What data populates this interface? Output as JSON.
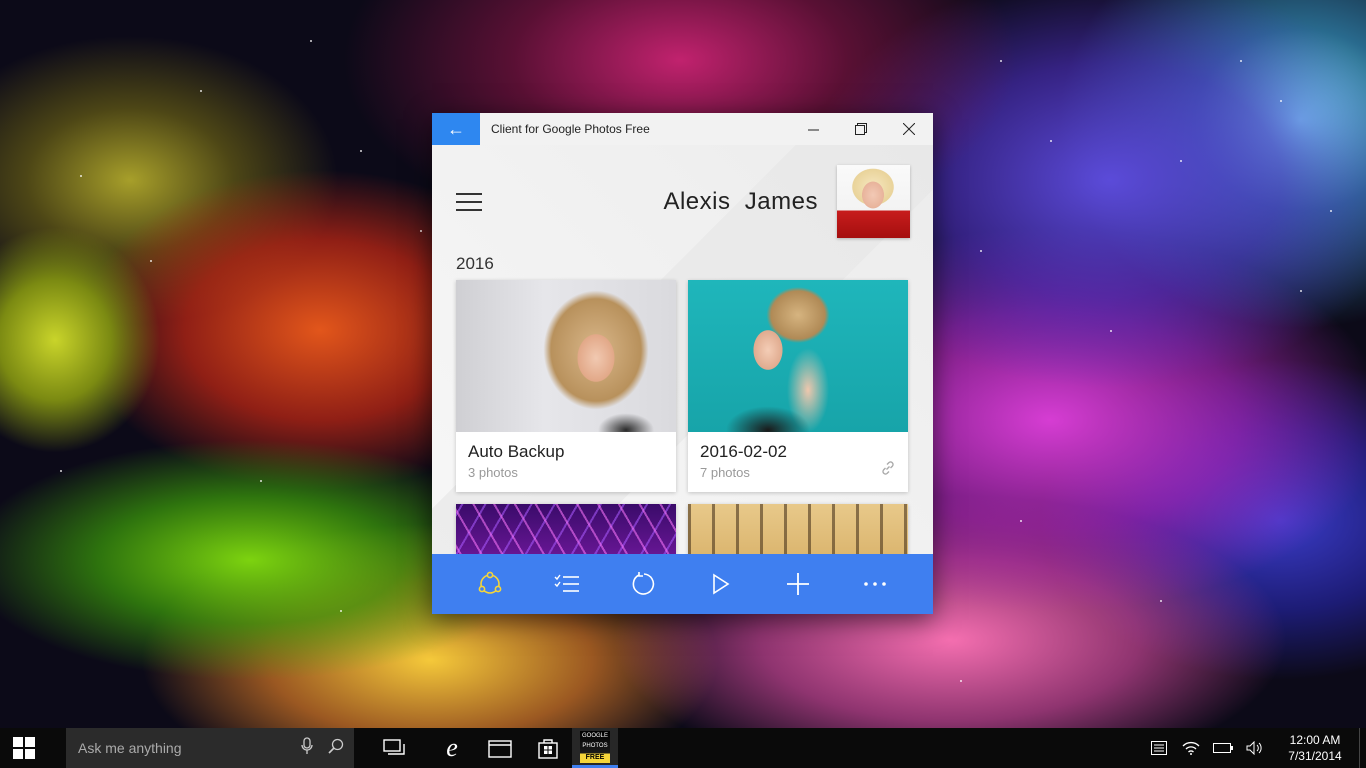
{
  "window": {
    "title": "Client for Google Photos Free",
    "back_icon": "arrow-left-icon",
    "minimize_icon": "minimize-icon",
    "restore_icon": "restore-icon",
    "close_icon": "close-icon"
  },
  "header": {
    "user_name": "Alexis  James",
    "year": "2016"
  },
  "albums": [
    {
      "title": "Auto Backup",
      "count": "3 photos"
    },
    {
      "title": "2016-02-02",
      "count": "7 photos",
      "shared_icon": "link-icon"
    },
    {
      "title": "",
      "count": ""
    },
    {
      "title": "",
      "count": ""
    }
  ],
  "appbar": {
    "buttons": [
      {
        "icon": "share-circle-icon"
      },
      {
        "icon": "select-list-icon"
      },
      {
        "icon": "refresh-icon"
      },
      {
        "icon": "play-icon"
      },
      {
        "icon": "add-icon"
      },
      {
        "icon": "more-icon"
      }
    ],
    "color": "#3f7ff0",
    "accent": "#f5d53a"
  },
  "taskbar": {
    "search_placeholder": "Ask me anything",
    "app_label_top": "GOOGLE",
    "app_label_mid": "PHOTOS",
    "app_label_bottom": "FREE",
    "time": "12:00 AM",
    "date": "7/31/2014"
  }
}
